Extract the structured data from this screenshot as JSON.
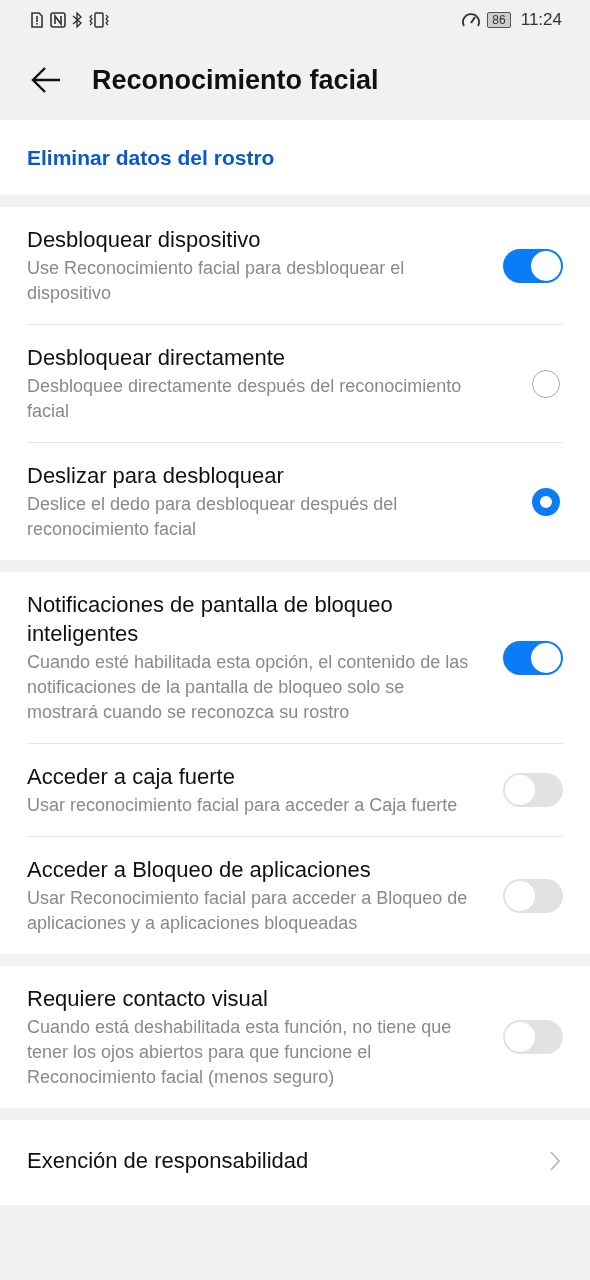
{
  "status_bar": {
    "battery": "86",
    "time": "11:24"
  },
  "header": {
    "title": "Reconocimiento facial"
  },
  "link": "Eliminar datos del rostro",
  "groups": [
    {
      "rows": [
        {
          "kind": "toggle",
          "title": "Desbloquear dispositivo",
          "subtitle": "Use Reconocimiento facial para desbloquear el dispositivo",
          "on": true
        },
        {
          "kind": "radio",
          "title": "Desbloquear directamente",
          "subtitle": "Desbloquee directamente después del reconocimiento facial",
          "selected": false
        },
        {
          "kind": "radio",
          "title": "Deslizar para desbloquear",
          "subtitle": "Deslice el dedo para desbloquear después del reconocimiento facial",
          "selected": true
        }
      ]
    },
    {
      "rows": [
        {
          "kind": "toggle",
          "title": "Notificaciones de pantalla de bloqueo inteligentes",
          "subtitle": "Cuando esté habilitada esta opción, el contenido de las notificaciones de la pantalla de bloqueo solo se mostrará cuando se reconozca su rostro",
          "on": true
        },
        {
          "kind": "toggle",
          "title": "Acceder a caja fuerte",
          "subtitle": "Usar reconocimiento facial para acceder a Caja fuerte",
          "on": false
        },
        {
          "kind": "toggle",
          "title": "Acceder a Bloqueo de aplicaciones",
          "subtitle": "Usar Reconocimiento facial para acceder a Bloqueo de aplicaciones y a aplicaciones bloqueadas",
          "on": false
        }
      ]
    },
    {
      "rows": [
        {
          "kind": "toggle",
          "title": "Requiere contacto visual",
          "subtitle": "Cuando está deshabilitada esta función, no tiene que tener los ojos abiertos para que funcione el Reconocimiento facial (menos seguro)",
          "on": false
        }
      ]
    },
    {
      "rows": [
        {
          "kind": "link",
          "title": "Exención de responsabilidad"
        }
      ]
    }
  ]
}
